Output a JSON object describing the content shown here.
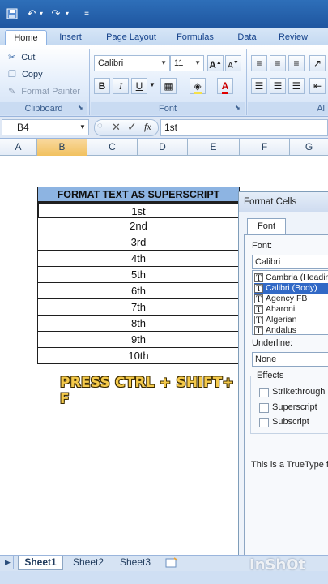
{
  "title_bar": {
    "icons": [
      "save-icon",
      "undo-icon",
      "redo-icon",
      "customize-icon"
    ]
  },
  "tabs": [
    {
      "label": "Home",
      "active": true
    },
    {
      "label": "Insert"
    },
    {
      "label": "Page Layout"
    },
    {
      "label": "Formulas"
    },
    {
      "label": "Data"
    },
    {
      "label": "Review"
    }
  ],
  "ribbon": {
    "clipboard": {
      "cut": "Cut",
      "copy": "Copy",
      "format_painter": "Format Painter",
      "label": "Clipboard"
    },
    "font": {
      "font_name": "Calibri",
      "font_size": "11",
      "bold": "B",
      "italic": "I",
      "underline": "U",
      "label": "Font"
    },
    "alignment": {
      "label": "Al"
    }
  },
  "formula_bar": {
    "name_box": "B4",
    "fx": "fx",
    "value": "1st"
  },
  "columns": [
    "A",
    "B",
    "C",
    "D",
    "E",
    "F",
    "G"
  ],
  "selected_column": "B",
  "table": {
    "header": "FORMAT TEXT AS SUPERSCRIPT",
    "rows": [
      "1st",
      "2nd",
      "3rd",
      "4th",
      "5th",
      "6th",
      "7th",
      "8th",
      "9th",
      "10th"
    ]
  },
  "overlay_text": "PRESS CTRL + SHIFT+ F",
  "dialog": {
    "title": "Format Cells",
    "tab": "Font",
    "font_label": "Font:",
    "font_value": "Calibri",
    "fonts": [
      "Cambria (Headin",
      "Calibri (Body)",
      "Agency FB",
      "Aharoni",
      "Algerian",
      "Andalus"
    ],
    "selected_font_index": 1,
    "underline_label": "Underline:",
    "underline_value": "None",
    "effects_label": "Effects",
    "effects": [
      "Strikethrough",
      "Superscript",
      "Subscript"
    ],
    "note": "This is a TrueType fo"
  },
  "sheet_tabs": [
    "Sheet1",
    "Sheet2",
    "Sheet3"
  ],
  "active_sheet": "Sheet1",
  "watermark": "InShOt",
  "colors": {
    "header_fill": "#8db4e2",
    "title_bar": "#1f56a0",
    "selection": "#3169c6",
    "overlay": "#f4c94a"
  }
}
